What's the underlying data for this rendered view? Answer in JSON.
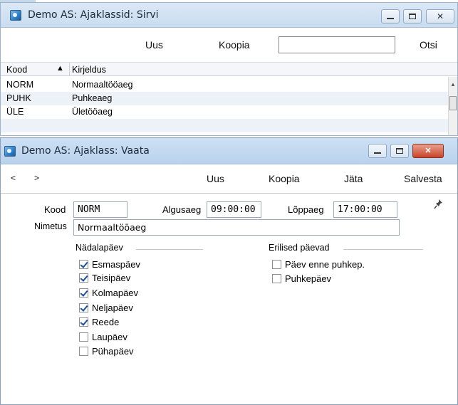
{
  "browse_window": {
    "title": "Demo AS: Ajaklassid: Sirvi",
    "toolbar": {
      "new": "Uus",
      "copy": "Koopia",
      "search_value": "",
      "search_button": "Otsi"
    },
    "columns": [
      "Kood",
      "Kirjeldus"
    ],
    "sort_indicator": "▲",
    "rows": [
      {
        "code": "NORM",
        "desc": "Normaaltööaeg"
      },
      {
        "code": "PUHK",
        "desc": "Puhkeaeg"
      },
      {
        "code": "ÜLE",
        "desc": "Ületööaeg"
      }
    ]
  },
  "edit_window": {
    "title": "Demo AS: Ajaklass: Vaata",
    "nav": {
      "prev": "<",
      "next": ">"
    },
    "toolbar": {
      "new": "Uus",
      "copy": "Koopia",
      "discard": "Jäta",
      "save": "Salvesta"
    },
    "form": {
      "code_label": "Kood",
      "code_value": "NORM",
      "start_label": "Algusaeg",
      "start_value": "09:00:00",
      "end_label": "Lõppaeg",
      "end_value": "17:00:00",
      "name_label": "Nimetus",
      "name_value": "Normaaltööaeg"
    },
    "weekdays": {
      "title": "Nädalapäev",
      "items": [
        {
          "label": "Esmaspäev",
          "checked": true
        },
        {
          "label": "Teisipäev",
          "checked": true
        },
        {
          "label": "Kolmapäev",
          "checked": true
        },
        {
          "label": "Neljapäev",
          "checked": true
        },
        {
          "label": "Reede",
          "checked": true
        },
        {
          "label": "Laupäev",
          "checked": false
        },
        {
          "label": "Pühapäev",
          "checked": false
        }
      ]
    },
    "special": {
      "title": "Erilised päevad",
      "items": [
        {
          "label": "Päev enne puhkep.",
          "checked": false
        },
        {
          "label": "Puhkepäev",
          "checked": false
        }
      ]
    }
  }
}
